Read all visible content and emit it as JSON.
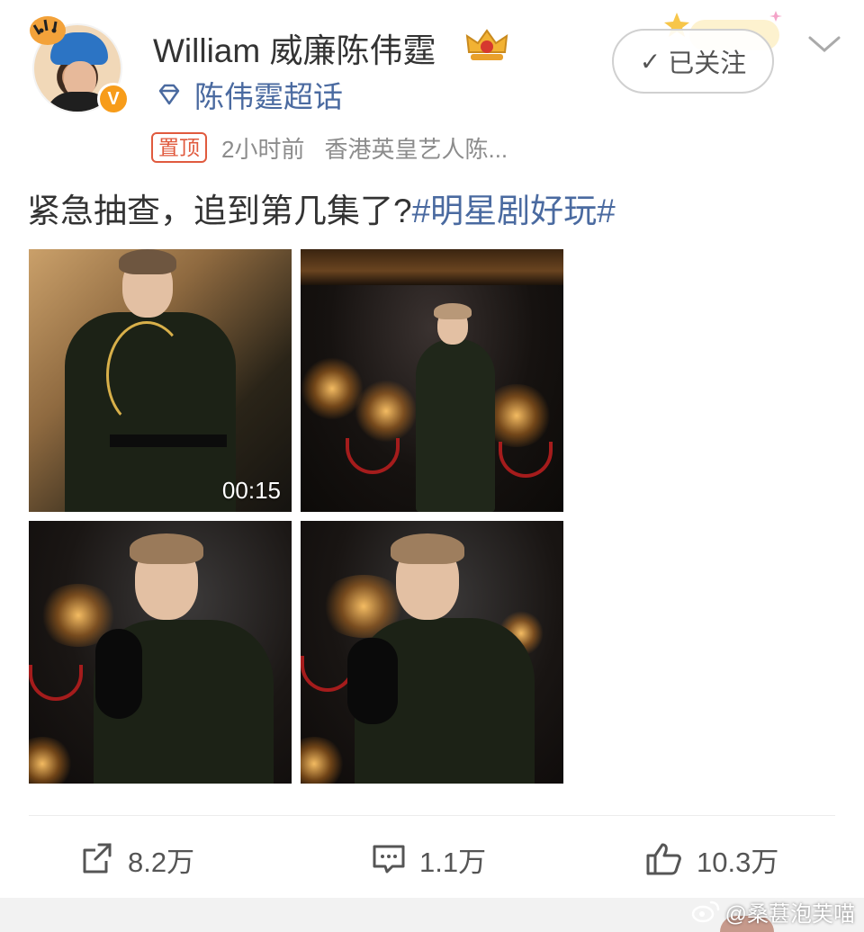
{
  "user": {
    "name": "William 威廉陈伟霆",
    "supertopic": "陈伟霆超话",
    "verified_badge": "V"
  },
  "post": {
    "pinned_label": "置顶",
    "time": "2小时前",
    "source": "香港英皇艺人陈...",
    "text": "紧急抽查，追到第几集了?",
    "hashtag": "#明星剧好玩#"
  },
  "follow_button": {
    "label": "已关注"
  },
  "media": {
    "video_duration": "00:15",
    "photo_count": 4
  },
  "actions": {
    "reposts": "8.2万",
    "comments": "1.1万",
    "likes": "10.3万"
  },
  "watermark": {
    "text": "@桑葚泡芙喵"
  },
  "colors": {
    "link_blue": "#4a6aa0",
    "pin_red": "#e05a3e",
    "verified_orange": "#f79c1a"
  }
}
